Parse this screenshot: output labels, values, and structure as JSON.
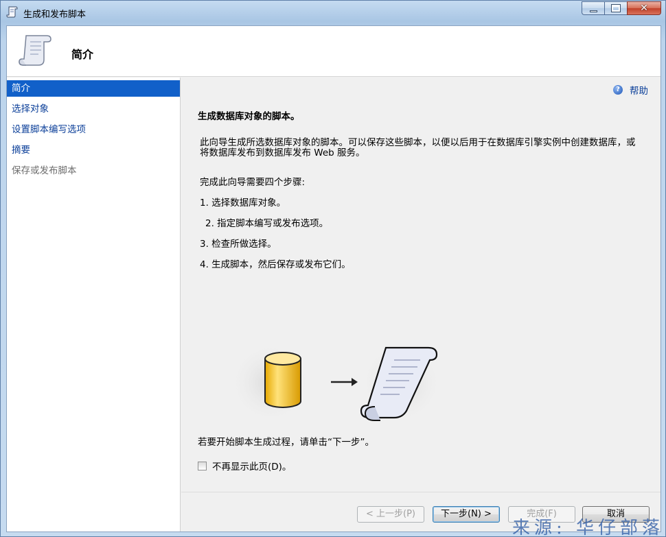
{
  "window": {
    "title": "生成和发布脚本"
  },
  "header": {
    "title": "简介"
  },
  "sidebar": {
    "items": [
      {
        "label": "简介",
        "state": "active"
      },
      {
        "label": "选择对象",
        "state": "link"
      },
      {
        "label": "设置脚本编写选项",
        "state": "link"
      },
      {
        "label": "摘要",
        "state": "link"
      },
      {
        "label": "保存或发布脚本",
        "state": "disabled"
      }
    ]
  },
  "content": {
    "help_label": "帮助",
    "heading": "生成数据库对象的脚本。",
    "description": "此向导生成所选数据库对象的脚本。可以保存这些脚本，以便以后用于在数据库引擎实例中创建数据库，或将数据库发布到数据库发布 Web 服务。",
    "steps_intro": "完成此向导需要四个步骤:",
    "steps": [
      "1.  选择数据库对象。",
      "2.  指定脚本编写或发布选项。",
      "3.  检查所做选择。",
      "4.  生成脚本，然后保存或发布它们。"
    ],
    "start_hint": "若要开始脚本生成过程，请单击“下一步”。",
    "checkbox_label": "不再显示此页(D)。",
    "checkbox_checked": false
  },
  "footer": {
    "prev_label": "< 上一步(P)",
    "next_label": "下一步(N) >",
    "finish_label": "完成(F)",
    "cancel_label": "取消"
  },
  "watermark": "来源: 华仔部落",
  "colors": {
    "selection": "#1160c9",
    "link": "#0b3f99"
  }
}
